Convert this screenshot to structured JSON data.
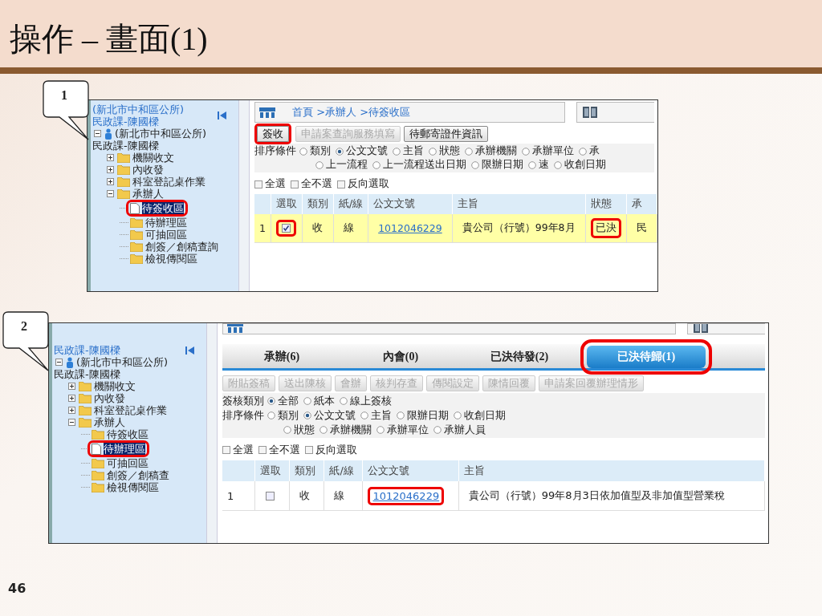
{
  "slide": {
    "title": "操作 – 畫面(1)",
    "page_number": "46"
  },
  "panels": [
    {
      "callout": "1",
      "sidebar": {
        "title": "(新北市中和區公所)",
        "subtitle": "民政課-陳國樑",
        "tree": [
          {
            "kind": "user",
            "label": "(新北市中和區公所)",
            "sublabel": "民政課-陳國樑",
            "expanded": true,
            "selected": false,
            "marked": false,
            "children": [
              {
                "kind": "folder",
                "label": "機關收文",
                "expanded": false,
                "selected": false,
                "marked": false
              },
              {
                "kind": "folder",
                "label": "內收發",
                "expanded": false,
                "selected": false,
                "marked": false
              },
              {
                "kind": "folder",
                "label": "科室登記桌作業",
                "expanded": false,
                "selected": false,
                "marked": false
              },
              {
                "kind": "folder",
                "label": "承辦人",
                "expanded": true,
                "selected": false,
                "marked": false,
                "children": [
                  {
                    "kind": "document",
                    "label": "待簽收區",
                    "selected": true,
                    "marked": true
                  },
                  {
                    "kind": "folder",
                    "label": "待辦理區",
                    "selected": false,
                    "marked": false
                  },
                  {
                    "kind": "folder",
                    "label": "可抽回區",
                    "selected": false,
                    "marked": false
                  },
                  {
                    "kind": "folder",
                    "label": "創簽／創稿查詢",
                    "selected": false,
                    "marked": false
                  },
                  {
                    "kind": "folder",
                    "label": "檢視傳閱區",
                    "selected": false,
                    "marked": false
                  }
                ]
              }
            ]
          }
        ]
      },
      "breadcrumb": "首頁 >承辦人 >待簽收區",
      "buttons": [
        {
          "label": "簽收",
          "disabled": false,
          "marked": true
        },
        {
          "label": "申請案查詢服務填寫",
          "disabled": true,
          "marked": false
        },
        {
          "label": "待郵寄證件資訊",
          "disabled": false,
          "marked": false
        }
      ],
      "filters": [
        {
          "label": "排序條件",
          "lines": [
            {
              "options": [
                {
                  "label": "類別",
                  "selected": false
                },
                {
                  "label": "公文文號",
                  "selected": true
                },
                {
                  "label": "主旨",
                  "selected": false
                },
                {
                  "label": "狀態",
                  "selected": false
                },
                {
                  "label": "承辦機關",
                  "selected": false
                },
                {
                  "label": "承辦單位",
                  "selected": false
                },
                {
                  "label": "承",
                  "selected": false
                }
              ]
            },
            {
              "options": [
                {
                  "label": "上一流程",
                  "selected": false
                },
                {
                  "label": "上一流程送出日期",
                  "selected": false
                },
                {
                  "label": "限辦日期",
                  "selected": false
                },
                {
                  "label": "速",
                  "selected": false
                },
                {
                  "label": "收創日期",
                  "selected": false
                }
              ]
            }
          ]
        }
      ],
      "select_options": [
        "全選",
        "全不選",
        "反向選取"
      ],
      "table": {
        "columns": [
          "選取",
          "類別",
          "紙/線",
          "公文文號",
          "主旨",
          "狀態",
          "承"
        ],
        "rows": [
          {
            "number": "1",
            "highlighted": true,
            "cells": [
              {
                "kind": "checkbox",
                "checked": true,
                "marked": true
              },
              {
                "kind": "text",
                "text": "收",
                "marked": false
              },
              {
                "kind": "text",
                "text": "線",
                "marked": false
              },
              {
                "kind": "link",
                "text": "1012046229",
                "marked": false
              },
              {
                "kind": "text",
                "text": "貴公司（行號）99年8月",
                "marked": false
              },
              {
                "kind": "text",
                "text": "已決",
                "marked": true
              },
              {
                "kind": "text",
                "text": "民",
                "marked": false
              }
            ]
          }
        ]
      }
    },
    {
      "callout": "2",
      "sidebar": {
        "subtitle": "民政課-陳國樑",
        "tree": [
          {
            "kind": "user",
            "label": "(新北市中和區公所)",
            "sublabel": "民政課-陳國樑",
            "expanded": true,
            "selected": false,
            "marked": false,
            "children": [
              {
                "kind": "folder",
                "label": "機關收文",
                "expanded": false,
                "selected": false,
                "marked": false
              },
              {
                "kind": "folder",
                "label": "內收發",
                "expanded": false,
                "selected": false,
                "marked": false
              },
              {
                "kind": "folder",
                "label": "科室登記桌作業",
                "expanded": false,
                "selected": false,
                "marked": false
              },
              {
                "kind": "folder",
                "label": "承辦人",
                "expanded": true,
                "selected": false,
                "marked": false,
                "children": [
                  {
                    "kind": "folder",
                    "label": "待簽收區",
                    "selected": false,
                    "marked": false
                  },
                  {
                    "kind": "document",
                    "label": "待辦理區",
                    "selected": true,
                    "marked": true
                  },
                  {
                    "kind": "folder",
                    "label": "可抽回區",
                    "selected": false,
                    "marked": false
                  },
                  {
                    "kind": "folder",
                    "label": "創簽／創稿查",
                    "selected": false,
                    "marked": false
                  },
                  {
                    "kind": "folder",
                    "label": "檢視傳閱區",
                    "selected": false,
                    "marked": false
                  }
                ]
              }
            ]
          }
        ]
      },
      "tabs": [
        {
          "label": "承辦(6)",
          "selected": false,
          "marked": false
        },
        {
          "label": "內會(0)",
          "selected": false,
          "marked": false
        },
        {
          "label": "已決待發(2)",
          "selected": false,
          "marked": false
        },
        {
          "label": "已決待歸(1)",
          "selected": true,
          "marked": true
        }
      ],
      "buttons": [
        {
          "label": "附貼簽稿",
          "disabled": true,
          "marked": false
        },
        {
          "label": "送出陳核",
          "disabled": true,
          "marked": false
        },
        {
          "label": "會辦",
          "disabled": true,
          "marked": false
        },
        {
          "label": "核判存查",
          "disabled": true,
          "marked": false
        },
        {
          "label": "傳閱設定",
          "disabled": true,
          "marked": false
        },
        {
          "label": "陳情回覆",
          "disabled": true,
          "marked": false
        },
        {
          "label": "申請案回覆辦理情形",
          "disabled": true,
          "marked": false
        }
      ],
      "filters": [
        {
          "label": "簽核類別",
          "lines": [
            {
              "options": [
                {
                  "label": "全部",
                  "selected": true
                },
                {
                  "label": "紙本",
                  "selected": false
                },
                {
                  "label": "線上簽核",
                  "selected": false
                }
              ]
            }
          ]
        },
        {
          "label": "排序條件",
          "lines": [
            {
              "options": [
                {
                  "label": "類別",
                  "selected": false
                },
                {
                  "label": "公文文號",
                  "selected": true
                },
                {
                  "label": "主旨",
                  "selected": false
                },
                {
                  "label": "限辦日期",
                  "selected": false
                },
                {
                  "label": "收創日期",
                  "selected": false
                }
              ]
            },
            {
              "options": [
                {
                  "label": "狀態",
                  "selected": false
                },
                {
                  "label": "承辦機關",
                  "selected": false
                },
                {
                  "label": "承辦單位",
                  "selected": false
                },
                {
                  "label": "承辦人員",
                  "selected": false
                }
              ]
            }
          ]
        }
      ],
      "select_options": [
        "全選",
        "全不選",
        "反向選取"
      ],
      "table": {
        "columns": [
          "選取",
          "類別",
          "紙/線",
          "公文文號",
          "主旨"
        ],
        "rows": [
          {
            "number": "1",
            "highlighted": false,
            "cells": [
              {
                "kind": "checkbox",
                "checked": false,
                "marked": false
              },
              {
                "kind": "text",
                "text": "收",
                "marked": false
              },
              {
                "kind": "text",
                "text": "線",
                "marked": false
              },
              {
                "kind": "link",
                "text": "1012046229",
                "marked": true
              },
              {
                "kind": "text",
                "text": "貴公司（行號）99年8月3日依加值型及非加值型營業稅",
                "marked": false
              }
            ]
          }
        ]
      }
    }
  ]
}
